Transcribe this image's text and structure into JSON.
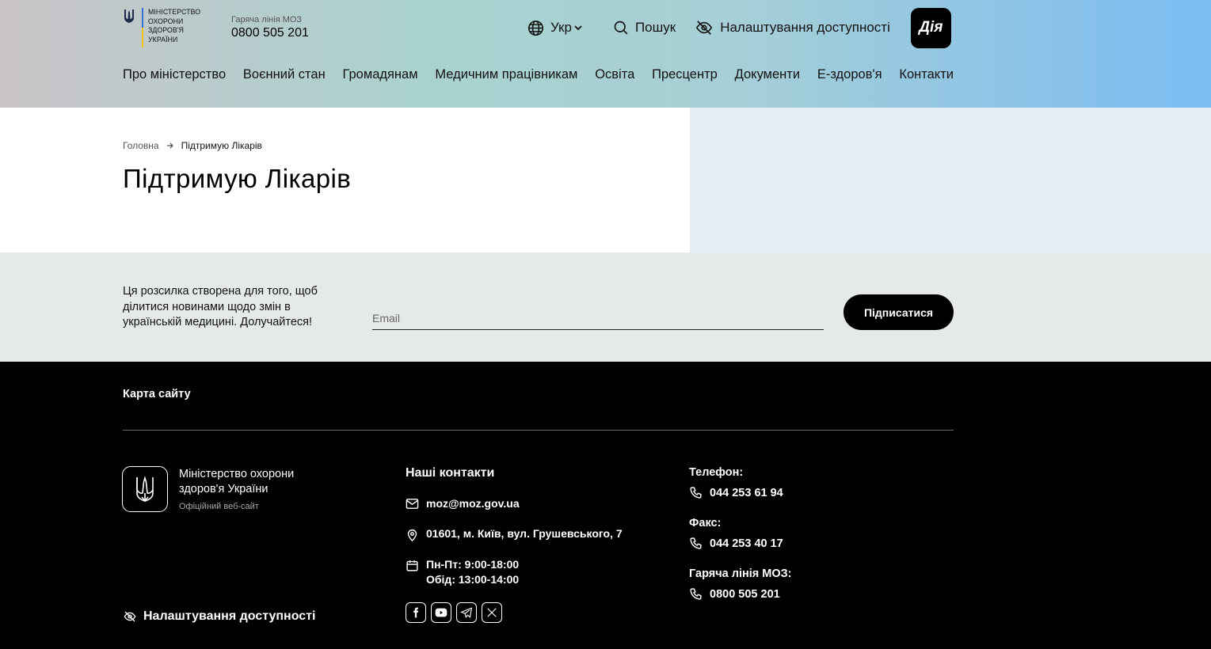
{
  "header": {
    "logo_text": "Міністерство охорони здоров'я України",
    "hotline_label": "Гаряча лінія МОЗ",
    "hotline_phone": "0800 505 201",
    "lang_label": "Укр",
    "search_label": "Пошук",
    "accessibility_label": "Налаштування доступності",
    "diya_label": "Дія"
  },
  "nav": {
    "items": [
      {
        "label": "Про міністерство"
      },
      {
        "label": "Воєнний стан"
      },
      {
        "label": "Громадянам"
      },
      {
        "label": "Медичним працівникам"
      },
      {
        "label": "Освіта"
      },
      {
        "label": "Пресцентр"
      },
      {
        "label": "Документи"
      },
      {
        "label": "Е-здоров'я"
      },
      {
        "label": "Контакти"
      }
    ]
  },
  "breadcrumb": {
    "home": "Головна",
    "current": "Підтримую Лікарів"
  },
  "page": {
    "title": "Підтримую Лікарів"
  },
  "newsletter": {
    "text": "Ця розсилка створена для того, щоб ділитися новинами щодо змін в українській медицині. Долучайтеся!",
    "email_placeholder": "Email",
    "email_value": "",
    "subscribe_label": "Підписатися"
  },
  "footer": {
    "sitemap_label": "Карта сайту",
    "org_name": "Міністерство охорони здоров'я України",
    "official_site": "Офіційний веб-сайт",
    "accessibility_label": "Налаштування доступності",
    "contacts_title": "Наші контакти",
    "email": "moz@moz.gov.ua",
    "address": "01601, м. Київ, вул. Грушевського, 7",
    "hours_1": "Пн-Пт: 9:00-18:00",
    "hours_2": "Обід: 13:00-14:00",
    "phone_label": "Телефон:",
    "phone": "044 253 61 94",
    "fax_label": "Факс:",
    "fax": "044 253 40 17",
    "hotline_label": "Гаряча лінія МОЗ:",
    "hotline": "0800 505 201",
    "socials": [
      "facebook-icon",
      "youtube-icon",
      "telegram-icon",
      "x-icon"
    ]
  }
}
